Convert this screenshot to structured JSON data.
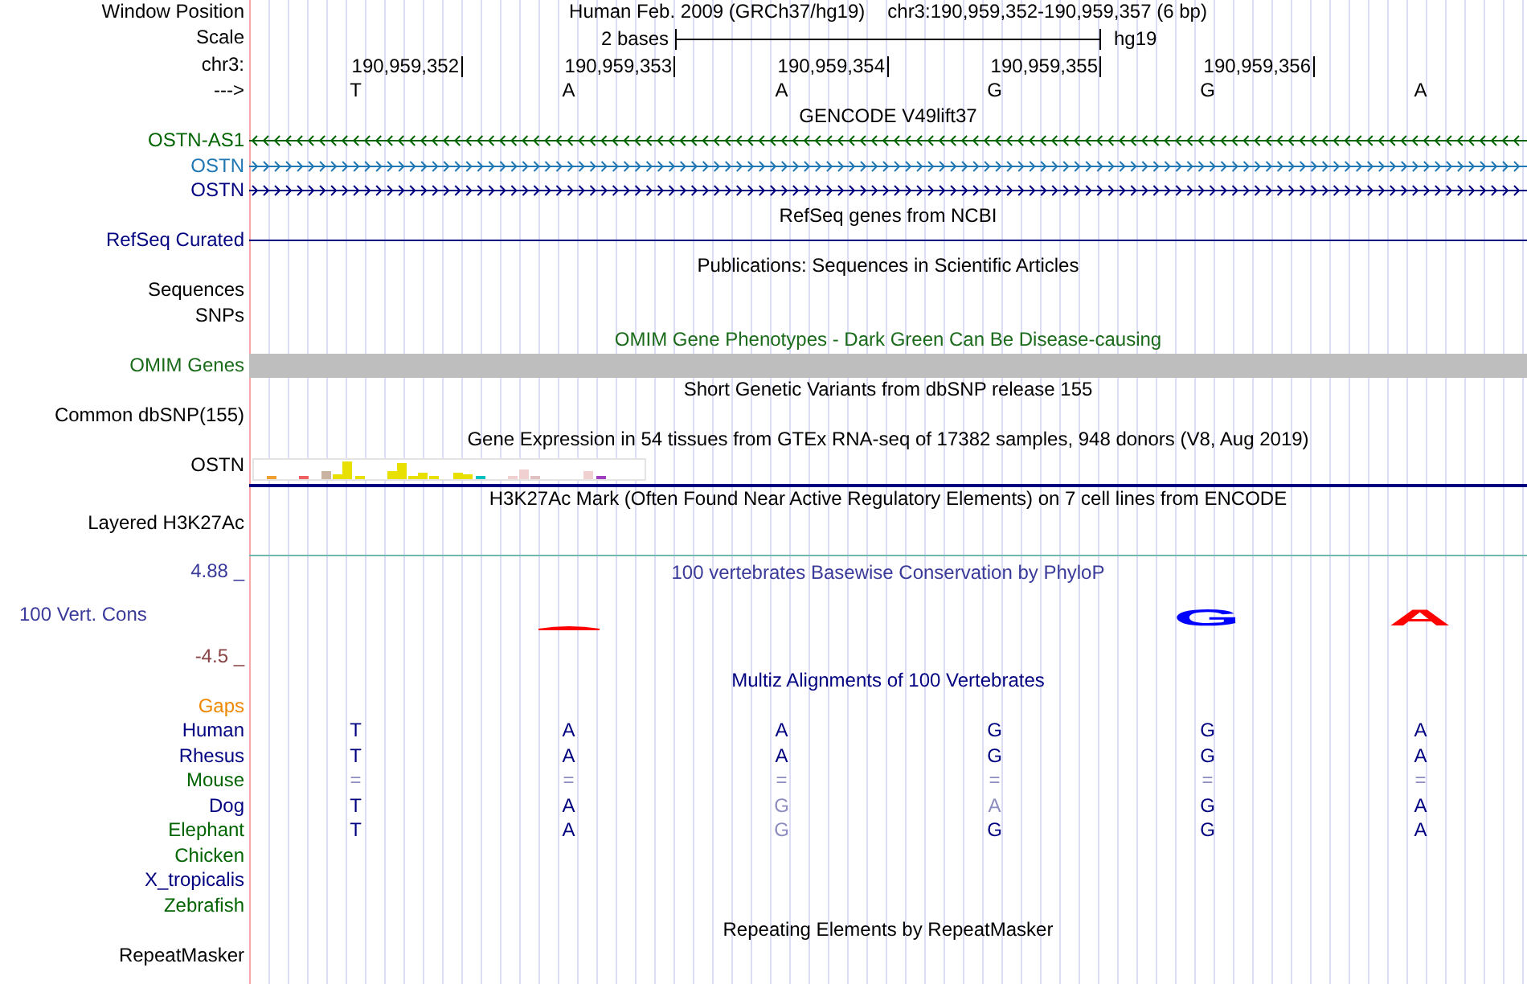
{
  "header": {
    "position_label": "Window Position",
    "assembly": "Human Feb. 2009 (GRCh37/hg19)",
    "range": "chr3:190,959,352-190,959,357 (6 bp)",
    "scale_label": "Scale",
    "scale_text": "2 bases",
    "scale_db": "hg19",
    "chrom_label": "chr3:",
    "positions": [
      "190,959,352",
      "190,959,353",
      "190,959,354",
      "190,959,355",
      "190,959,356"
    ],
    "strand_label": "--->",
    "bases": [
      "T",
      "A",
      "A",
      "G",
      "G",
      "A"
    ]
  },
  "tracks": [
    {
      "kind": "genes",
      "title": "GENCODE V49lift37",
      "items": [
        {
          "label": "OSTN-AS1",
          "color": "#006400",
          "kind": "minus-strand"
        },
        {
          "label": "OSTN",
          "color": "#1f77b4",
          "kind": "plus-strand"
        },
        {
          "label": "OSTN",
          "color": "#000080",
          "kind": "plus-strand"
        }
      ]
    },
    {
      "kind": "genes",
      "title": "RefSeq genes from NCBI",
      "items": [
        {
          "label": "RefSeq Curated",
          "color": "#000080",
          "kind": "plain"
        }
      ]
    },
    {
      "kind": "labels",
      "title": "Publications: Sequences in Scientific Articles",
      "labels": [
        "Sequences",
        "SNPs"
      ]
    },
    {
      "kind": "omim",
      "title": "OMIM Gene Phenotypes - Dark Green Can Be Disease-causing",
      "label": "OMIM Genes"
    },
    {
      "kind": "labels",
      "title": "Short Genetic Variants from dbSNP release 155",
      "labels": [
        "Common dbSNP(155)"
      ]
    },
    {
      "kind": "expression",
      "title": "Gene Expression in 54 tissues from GTEx RNA-seq of 17382 samples, 948 donors (V8, Aug 2019)",
      "label": "OSTN"
    },
    {
      "kind": "signal",
      "title": "H3K27Ac Mark (Often Found Near Active Regulatory Elements) on 7 cell lines from ENCODE",
      "label": "Layered H3K27Ac"
    },
    {
      "kind": "conservation",
      "title": "100 vertebrates Basewise Conservation by PhyloP",
      "max_label": "4.88 _",
      "label": "100 Vert. Cons",
      "min_label": "-4.5 _",
      "logos": [
        {
          "kind": "none"
        },
        {
          "kind": "flat",
          "color": "#ff0000"
        },
        {
          "kind": "none"
        },
        {
          "kind": "none"
        },
        {
          "kind": "letter",
          "letter": "G",
          "color": "#0000ff"
        },
        {
          "kind": "letter",
          "letter": "A",
          "color": "#ff0000"
        }
      ]
    },
    {
      "kind": "alignment",
      "title": "Multiz Alignments of 100 Vertebrates",
      "rows": [
        {
          "label": "Gaps",
          "color": "#ee8800"
        },
        {
          "label": "Human",
          "color": "#000080",
          "bases": [
            {
              "base": "T",
              "faded": false
            },
            {
              "base": "A",
              "faded": false
            },
            {
              "base": "A",
              "faded": false
            },
            {
              "base": "G",
              "faded": false
            },
            {
              "base": "G",
              "faded": false
            },
            {
              "base": "A",
              "faded": false
            }
          ]
        },
        {
          "label": "Rhesus",
          "color": "#000080",
          "bases": [
            {
              "base": "T",
              "faded": false
            },
            {
              "base": "A",
              "faded": false
            },
            {
              "base": "A",
              "faded": false
            },
            {
              "base": "G",
              "faded": false
            },
            {
              "base": "G",
              "faded": false
            },
            {
              "base": "A",
              "faded": false
            }
          ]
        },
        {
          "label": "Mouse",
          "color": "#006400",
          "bases": [
            {
              "base": "=",
              "faded": true
            },
            {
              "base": "=",
              "faded": true
            },
            {
              "base": "=",
              "faded": true
            },
            {
              "base": "=",
              "faded": true
            },
            {
              "base": "=",
              "faded": true
            },
            {
              "base": "=",
              "faded": true
            }
          ]
        },
        {
          "label": "Dog",
          "color": "#000080",
          "bases": [
            {
              "base": "T",
              "faded": false
            },
            {
              "base": "A",
              "faded": false
            },
            {
              "base": "G",
              "faded": true
            },
            {
              "base": "A",
              "faded": true
            },
            {
              "base": "G",
              "faded": false
            },
            {
              "base": "A",
              "faded": false
            }
          ]
        },
        {
          "label": "Elephant",
          "color": "#006400",
          "bases": [
            {
              "base": "T",
              "faded": false
            },
            {
              "base": "A",
              "faded": false
            },
            {
              "base": "G",
              "faded": true
            },
            {
              "base": "G",
              "faded": false
            },
            {
              "base": "G",
              "faded": false
            },
            {
              "base": "A",
              "faded": false
            }
          ]
        },
        {
          "label": "Chicken",
          "color": "#006400"
        },
        {
          "label": "X_tropicalis",
          "color": "#000080"
        },
        {
          "label": "Zebrafish",
          "color": "#006400"
        }
      ]
    },
    {
      "kind": "labels",
      "title": "Repeating Elements by RepeatMasker",
      "labels": [
        "RepeatMasker"
      ]
    }
  ]
}
